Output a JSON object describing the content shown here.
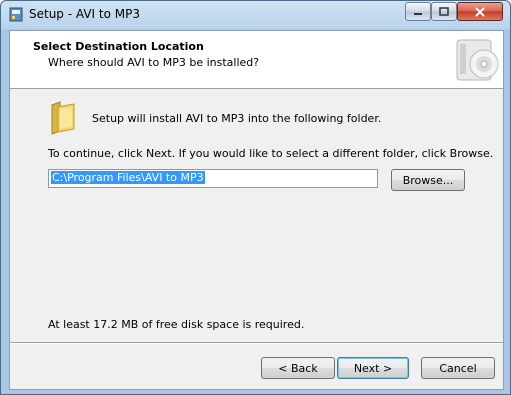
{
  "window": {
    "title": "Setup - AVI to MP3"
  },
  "header": {
    "title": "Select Destination Location",
    "subtitle": "Where should AVI to MP3 be installed?"
  },
  "body": {
    "intro": "Setup will install AVI to MP3 into the following folder.",
    "instruction": "To continue, click Next. If you would like to select a different folder, click Browse.",
    "path_value": "C:\\Program Files\\AVI to MP3",
    "browse_label": "Browse...",
    "disk_space": "At least 17.2 MB of free disk space is required."
  },
  "footer": {
    "back_label": "< Back",
    "next_label": "Next >",
    "cancel_label": "Cancel"
  },
  "icons": {
    "app": "setup-app-icon",
    "folder": "folder-icon",
    "header": "setup-disc-box-icon"
  }
}
